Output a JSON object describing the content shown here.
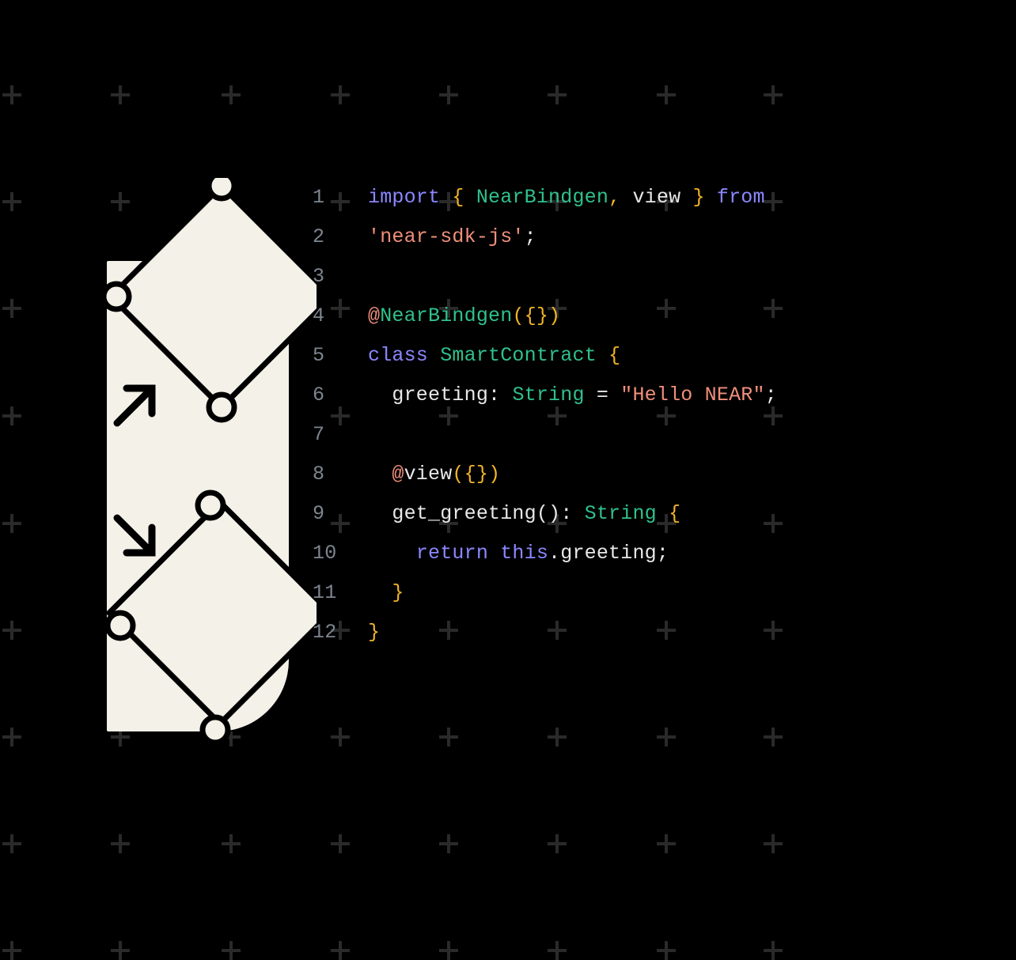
{
  "colors": {
    "bg": "#000000",
    "gutter": "#7d8590",
    "text": "#e8e8e8",
    "keyword": "#8b87ff",
    "type": "#2fc18c",
    "punc": "#f0b429",
    "string": "#f08f7b",
    "decorative_plus": "#2a2a2a",
    "illustration_fill": "#f4f1e8",
    "illustration_stroke": "#000000"
  },
  "code": {
    "lines": [
      {
        "n": "1",
        "tokens": [
          [
            "keyword",
            "import"
          ],
          [
            "default",
            " "
          ],
          [
            "punc",
            "{"
          ],
          [
            "default",
            " "
          ],
          [
            "type",
            "NearBindgen"
          ],
          [
            "punc",
            ","
          ],
          [
            "default",
            " view "
          ],
          [
            "punc",
            "}"
          ],
          [
            "default",
            " "
          ],
          [
            "keyword",
            "from"
          ]
        ]
      },
      {
        "n": "2",
        "tokens": [
          [
            "string",
            "'near-sdk-js'"
          ],
          [
            "default",
            ";"
          ]
        ]
      },
      {
        "n": "3",
        "tokens": []
      },
      {
        "n": "4",
        "tokens": [
          [
            "at",
            "@"
          ],
          [
            "type",
            "NearBindgen"
          ],
          [
            "punc",
            "({})"
          ]
        ]
      },
      {
        "n": "5",
        "tokens": [
          [
            "keyword",
            "class"
          ],
          [
            "default",
            " "
          ],
          [
            "type",
            "SmartContract"
          ],
          [
            "default",
            " "
          ],
          [
            "punc",
            "{"
          ]
        ]
      },
      {
        "n": "6",
        "tokens": [
          [
            "default",
            "  greeting: "
          ],
          [
            "type",
            "String"
          ],
          [
            "default",
            " = "
          ],
          [
            "string",
            "\"Hello NEAR\""
          ],
          [
            "default",
            ";"
          ]
        ]
      },
      {
        "n": "7",
        "tokens": []
      },
      {
        "n": "8",
        "tokens": [
          [
            "default",
            "  "
          ],
          [
            "at",
            "@"
          ],
          [
            "default",
            "view"
          ],
          [
            "punc",
            "({})"
          ]
        ]
      },
      {
        "n": "9",
        "tokens": [
          [
            "default",
            "  get_greeting(): "
          ],
          [
            "type",
            "String"
          ],
          [
            "default",
            " "
          ],
          [
            "punc",
            "{"
          ]
        ]
      },
      {
        "n": "10",
        "tokens": [
          [
            "default",
            "    "
          ],
          [
            "keyword",
            "return"
          ],
          [
            "default",
            " "
          ],
          [
            "keyword",
            "this"
          ],
          [
            "default",
            ".greeting;"
          ]
        ]
      },
      {
        "n": "11",
        "tokens": [
          [
            "default",
            "  "
          ],
          [
            "punc",
            "}"
          ]
        ]
      },
      {
        "n": "12",
        "tokens": [
          [
            "punc",
            "}"
          ]
        ]
      }
    ]
  },
  "illustration": {
    "name": "near-nodes-graphic",
    "description": "Decorative cream rectangle with diamond shapes, connecting lines, circular nodes, and outbound arrows"
  }
}
